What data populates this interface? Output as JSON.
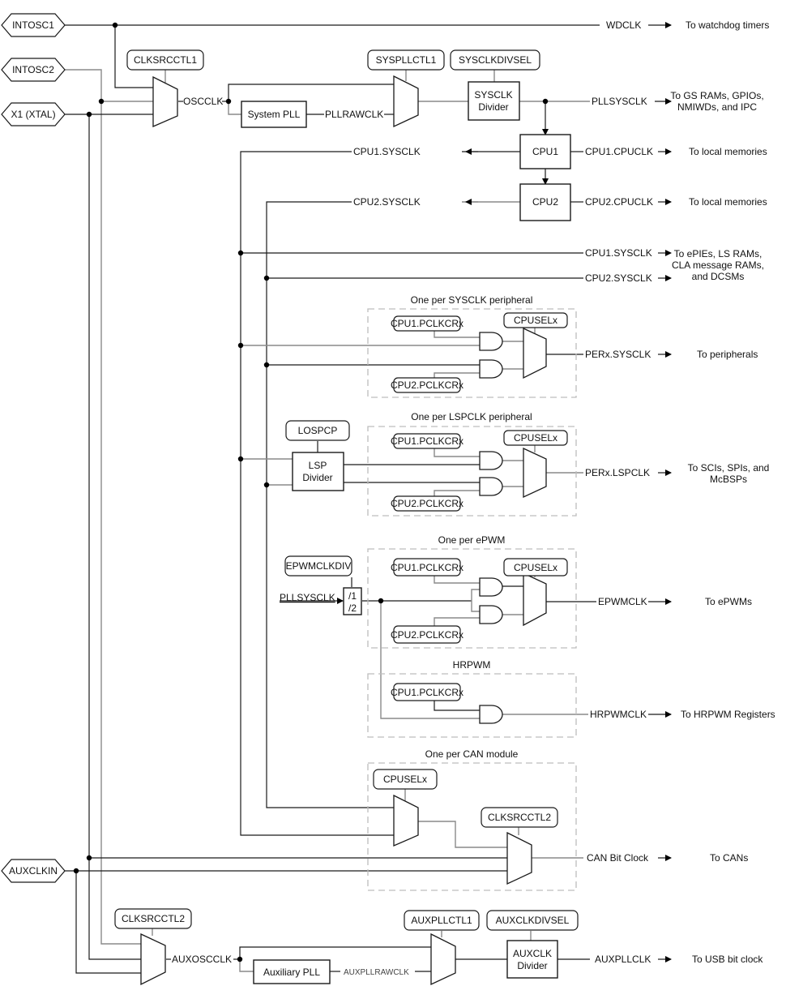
{
  "inputs": {
    "intosc1": "INTOSC1",
    "intosc2": "INTOSC2",
    "x1": "X1 (XTAL)",
    "auxclkin": "AUXCLKIN"
  },
  "registers": {
    "clksrcctl1": "CLKSRCCTL1",
    "syspllctl1": "SYSPLLCTL1",
    "sysclkdivsel": "SYSCLKDIVSEL",
    "cpusel_sys": "CPUSELx",
    "cpu1_pclkcr_sys": "CPU1.PCLKCRx",
    "cpu2_pclkcr_sys": "CPU2.PCLKCRx",
    "lospcp": "LOSPCP",
    "cpusel_lsp": "CPUSELx",
    "cpu1_pclkcr_lsp": "CPU1.PCLKCRx",
    "cpu2_pclkcr_lsp": "CPU2.PCLKCRx",
    "epwmclkdiv": "EPWMCLKDIV",
    "cpusel_epwm": "CPUSELx",
    "cpu1_pclkcr_epwm": "CPU1.PCLKCRx",
    "cpu2_pclkcr_epwm": "CPU2.PCLKCRx",
    "cpu1_pclkcr_hrpwm": "CPU1.PCLKCRx",
    "cpusel_can": "CPUSELx",
    "clksrcctl2_can": "CLKSRCCTL2",
    "clksrcctl2_aux": "CLKSRCCTL2",
    "auxpllctl1": "AUXPLLCTL1",
    "auxclkdivsel": "AUXCLKDIVSEL"
  },
  "blocks": {
    "system_pll": "System PLL",
    "sysclk_divider_l1": "SYSCLK",
    "sysclk_divider_l2": "Divider",
    "cpu1": "CPU1",
    "cpu2": "CPU2",
    "lsp_divider_l1": "LSP",
    "lsp_divider_l2": "Divider",
    "epwm_div_l1": "/1",
    "epwm_div_l2": "/2",
    "auxiliary_pll": "Auxiliary PLL",
    "auxclk_divider_l1": "AUXCLK",
    "auxclk_divider_l2": "Divider"
  },
  "signals": {
    "oscclk": "OSCCLK",
    "pllrawclk": "PLLRAWCLK",
    "wdclk": "WDCLK",
    "pllsysclk": "PLLSYSCLK",
    "cpu1_sysclk_a": "CPU1.SYSCLK",
    "cpu1_cpuclk": "CPU1.CPUCLK",
    "cpu2_sysclk_a": "CPU2.SYSCLK",
    "cpu2_cpuclk": "CPU2.CPUCLK",
    "cpu1_sysclk_b": "CPU1.SYSCLK",
    "cpu2_sysclk_b": "CPU2.SYSCLK",
    "perx_sysclk": "PERx.SYSCLK",
    "perx_lspclk": "PERx.LSPCLK",
    "pllsysclk_epwm": "PLLSYSCLK",
    "epwmclk": "EPWMCLK",
    "hrpwmclk": "HRPWMCLK",
    "can_bit_clock": "CAN Bit Clock",
    "auxoscclk": "AUXOSCCLK",
    "auxpllrawclk": "AUXPLLRAWCLK",
    "auxpllclk": "AUXPLLCLK"
  },
  "destinations": {
    "watchdog": "To watchdog timers",
    "gs_rams_l1": "To GS RAMs, GPIOs,",
    "gs_rams_l2": "NMIWDs, and IPC",
    "local_mem_1": "To local memories",
    "local_mem_2": "To local memories",
    "epies_l1": "To ePIEs, LS RAMs,",
    "epies_l2": "CLA message RAMs,",
    "epies_l3": "and DCSMs",
    "peripherals": "To peripherals",
    "scis_l1": "To SCIs, SPIs, and",
    "scis_l2": "McBSPs",
    "epwms": "To ePWMs",
    "hrpwm_regs": "To HRPWM Registers",
    "cans": "To CANs",
    "usb": "To USB bit clock"
  },
  "groups": {
    "sysclk_periph": "One per SYSCLK peripheral",
    "lspclk_periph": "One per LSPCLK peripheral",
    "epwm": "One per ePWM",
    "hrpwm": "HRPWM",
    "can": "One per CAN module"
  }
}
